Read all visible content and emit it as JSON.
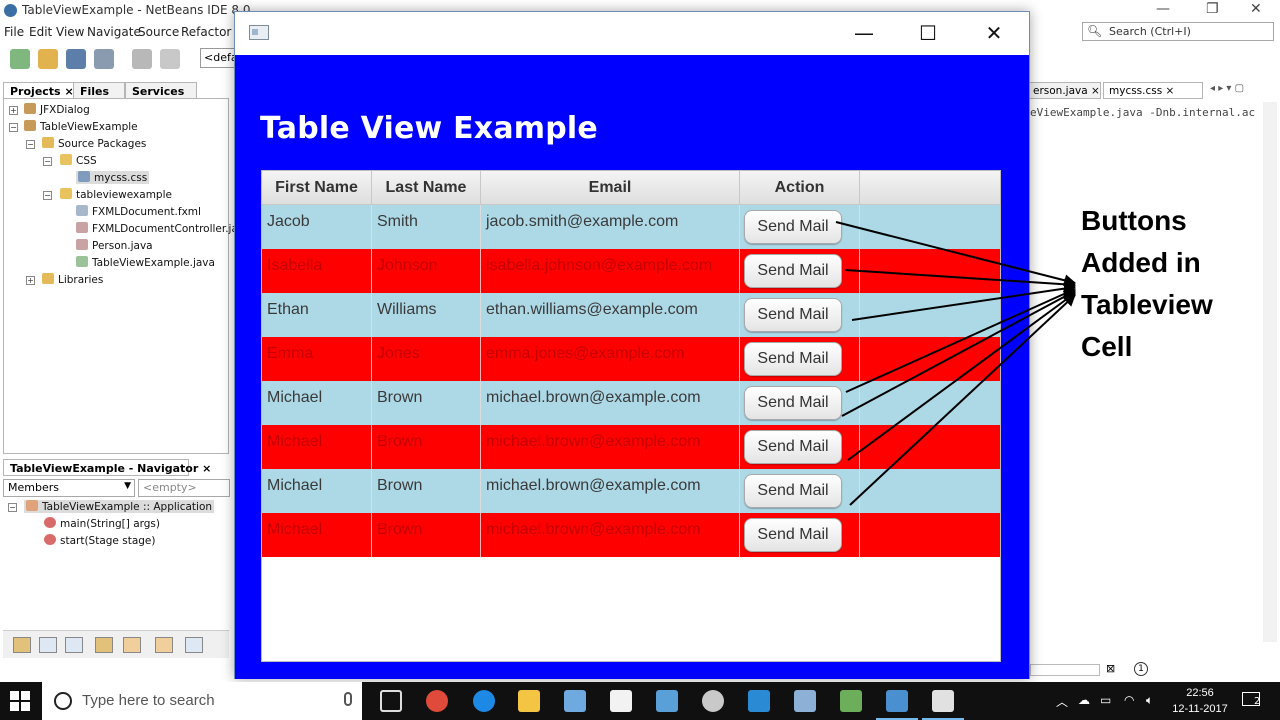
{
  "ide": {
    "title": "TableViewExample - NetBeans IDE 8.0",
    "menu": [
      "File",
      "Edit",
      "View",
      "Navigate",
      "Source",
      "Refactor"
    ],
    "config_value": "<defa",
    "search_placeholder": "Search (Ctrl+I)",
    "panel_tabs": [
      "Projects",
      "Files",
      "Services"
    ],
    "tree": [
      {
        "label": "JFXDialog"
      },
      {
        "label": "TableViewExample"
      },
      {
        "label": "Source Packages"
      },
      {
        "label": "CSS"
      },
      {
        "label": "mycss.css"
      },
      {
        "label": "tableviewexample"
      },
      {
        "label": "FXMLDocument.fxml"
      },
      {
        "label": "FXMLDocumentController.java"
      },
      {
        "label": "Person.java"
      },
      {
        "label": "TableViewExample.java"
      },
      {
        "label": "Libraries"
      }
    ],
    "navigator_title": "TableViewExample - Navigator",
    "navigator_select": "Members",
    "navigator_filter": "<empty>",
    "navigator_tree": [
      {
        "label": "TableViewExample :: Application"
      },
      {
        "label": "main(String[] args)"
      },
      {
        "label": "start(Stage stage)"
      }
    ],
    "editor_tabs": [
      "erson.java",
      "mycss.css"
    ],
    "code_line": "eViewExample.java -Dnb.internal.ac",
    "status_value": "1"
  },
  "app": {
    "heading": "Table View Example",
    "columns": [
      "First Name",
      "Last Name",
      "Email",
      "Action"
    ],
    "button_label": "Send Mail",
    "rows": [
      {
        "first": "Jacob",
        "last": "Smith",
        "email": "jacob.smith@example.com"
      },
      {
        "first": "Isabella",
        "last": "Johnson",
        "email": "isabella.johnson@example.com"
      },
      {
        "first": "Ethan",
        "last": "Williams",
        "email": "ethan.williams@example.com"
      },
      {
        "first": "Emma",
        "last": "Jones",
        "email": "emma.jones@example.com"
      },
      {
        "first": "Michael",
        "last": "Brown",
        "email": "michael.brown@example.com"
      },
      {
        "first": "Michael",
        "last": "Brown",
        "email": "michael.brown@example.com"
      },
      {
        "first": "Michael",
        "last": "Brown",
        "email": "michael.brown@example.com"
      },
      {
        "first": "Michael",
        "last": "Brown",
        "email": "michael.brown@example.com"
      }
    ],
    "colors": {
      "background": "#0000ff",
      "row_light": "#add8e6",
      "row_red": "#ff0000"
    }
  },
  "annotation": {
    "lines": [
      "Buttons",
      "Added in",
      "Tableview",
      "Cell"
    ]
  },
  "taskbar": {
    "search_placeholder": "Type here to search",
    "time": "22:56",
    "date": "12-11-2017",
    "notification_count": "2"
  }
}
